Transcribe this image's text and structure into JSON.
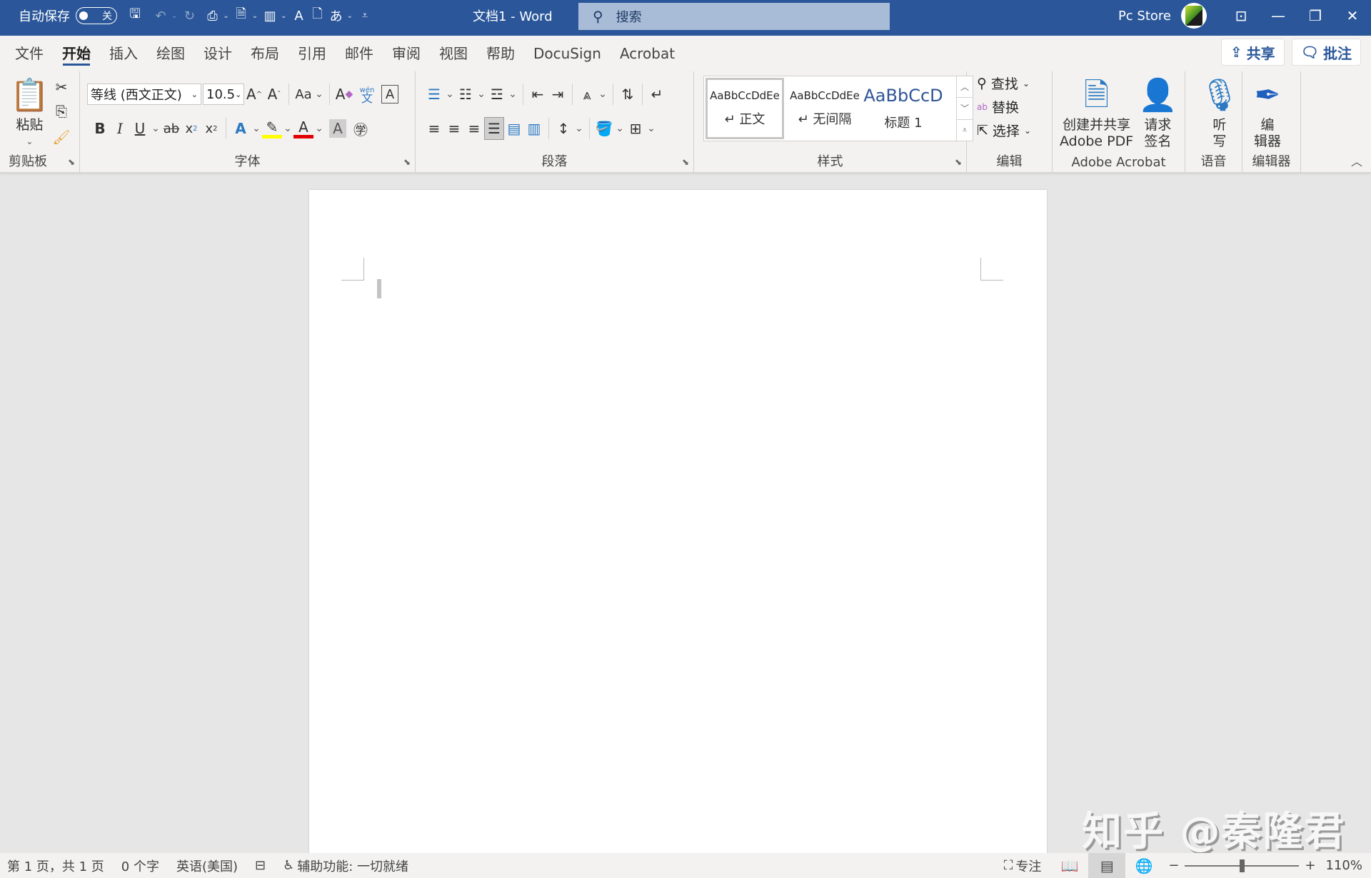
{
  "titlebar": {
    "autosave_label": "自动保存",
    "autosave_state": "关",
    "doc_title": "文档1  -  Word",
    "search_placeholder": "搜索",
    "account_name": "Pc Store",
    "bg_color": "#2b579a"
  },
  "tabs": [
    "文件",
    "开始",
    "插入",
    "绘图",
    "设计",
    "布局",
    "引用",
    "邮件",
    "审阅",
    "视图",
    "帮助",
    "DocuSign",
    "Acrobat"
  ],
  "active_tab": "开始",
  "share_label": "共享",
  "comments_label": "批注",
  "ribbon": {
    "clipboard": {
      "paste_label": "粘贴",
      "group_label": "剪贴板"
    },
    "font": {
      "font_name": "等线 (西文正文)",
      "font_size": "10.5",
      "case_label": "Aa",
      "pinyin_label": "wén",
      "group_label": "字体"
    },
    "paragraph": {
      "group_label": "段落"
    },
    "styles": {
      "items": [
        {
          "preview": "AaBbCcDdEe",
          "name": "↵ 正文"
        },
        {
          "preview": "AaBbCcDdEe",
          "name": "↵ 无间隔"
        },
        {
          "preview": "AaBbCcD",
          "name": "标题 1"
        }
      ],
      "group_label": "样式"
    },
    "editing": {
      "find": "查找",
      "replace": "替换",
      "select": "选择",
      "group_label": "编辑"
    },
    "acrobat": {
      "create_line1": "创建并共享",
      "create_line2": "Adobe PDF",
      "sign_line1": "请求",
      "sign_line2": "签名",
      "group_label": "Adobe Acrobat"
    },
    "voice": {
      "dictate_line1": "听",
      "dictate_line2": "写",
      "group_label": "语音"
    },
    "editor": {
      "line1": "编",
      "line2": "辑器",
      "group_label": "编辑器"
    }
  },
  "watermark": "知乎 @秦隆君",
  "status": {
    "page": "第 1 页，共 1 页",
    "words": "0 个字",
    "language": "英语(美国)",
    "accessibility": "辅助功能: 一切就绪",
    "focus": "专注",
    "zoom": "110%",
    "zoom_slider_fraction": 0.5
  }
}
